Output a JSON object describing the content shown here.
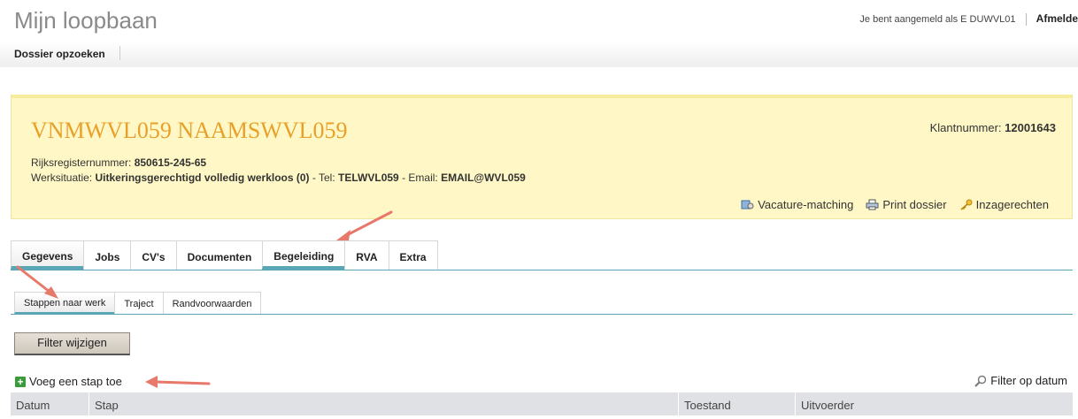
{
  "app": {
    "title": "Mijn loopbaan"
  },
  "user": {
    "logged_in_text": "Je bent aangemeld als E DUWVL01",
    "logout_label": "Afmelde"
  },
  "topnav": {
    "dossier_label": "Dossier opzoeken"
  },
  "client": {
    "name": "VNMWVL059 NAAMSWVL059",
    "number_label": "Klantnummer:",
    "number_value": "12001643",
    "rrn_label": "Rijksregisternummer:",
    "rrn_value": "850615-245-65",
    "werk_label": "Werksituatie:",
    "werk_value": "Uitkeringsgerechtigd volledig werkloos (0)",
    "tel_label": "- Tel:",
    "tel_value": "TELWVL059",
    "email_label": "- Email:",
    "email_value": "EMAIL@WVL059",
    "actions": {
      "vacature": "Vacature-matching",
      "print": "Print dossier",
      "inzage": "Inzagerechten"
    }
  },
  "tabs": [
    "Gegevens",
    "Jobs",
    "CV's",
    "Documenten",
    "Begeleiding",
    "RVA",
    "Extra"
  ],
  "subtabs": [
    "Stappen naar werk",
    "Traject",
    "Randvoorwaarden"
  ],
  "filter_button": "Filter wijzigen",
  "add_step": "Voeg een stap toe",
  "filter_date": "Filter op datum",
  "table": {
    "columns": [
      "Datum",
      "Stap",
      "Toestand",
      "Uitvoerder"
    ]
  },
  "colors": {
    "accent_teal": "#5aa6b7",
    "panel_yellow": "#fff8c6",
    "name_orange": "#e8a02a",
    "arrow_red": "#e8786a"
  }
}
